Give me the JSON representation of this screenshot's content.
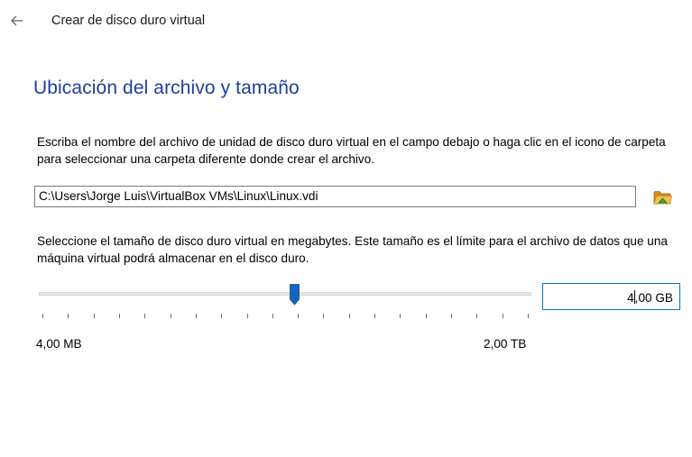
{
  "header": {
    "back_icon": "back-arrow-icon",
    "title": "Crear de disco duro virtual"
  },
  "location_section": {
    "heading": "Ubicación del archivo y tamaño",
    "file_description": "Escriba el nombre del archivo de unidad de disco duro virtual en el campo debajo o haga clic en el icono de carpeta para seleccionar una carpeta diferente donde crear el archivo.",
    "file_path": "C:\\Users\\Jorge Luis\\VirtualBox VMs\\Linux\\Linux.vdi",
    "folder_icon": "folder-icon",
    "size_description": "Seleccione el tamaño de disco duro virtual en megabytes. Este tamaño es el límite para el archivo de datos que una máquina virtual podrá almacenar en el disco duro.",
    "size_value_before_caret": "4",
    "size_value_after_caret": ",00 GB",
    "slider_position": 0.52,
    "tick_count": 20,
    "range_min_label": "4,00 MB",
    "range_max_label": "2,00 TB"
  },
  "colors": {
    "heading": "#1c3f9e",
    "slider_thumb": "#1565c0",
    "focus_border": "#0d6fd0",
    "folder_front": "#f2c14e",
    "folder_arrow": "#3aa845"
  }
}
